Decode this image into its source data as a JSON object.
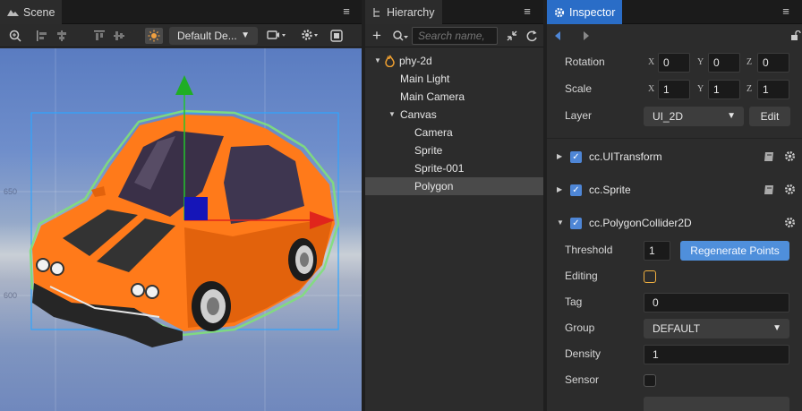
{
  "scene": {
    "tab_label": "Scene",
    "menu_icon": "≡",
    "camera_select": "Default De...",
    "ruler_labels": {
      "y650": "650",
      "y600": "600"
    }
  },
  "hierarchy": {
    "tab_label": "Hierarchy",
    "menu_icon": "≡",
    "search_placeholder": "Search name,",
    "tree": [
      {
        "label": "phy-2d",
        "depth": 0,
        "expanded": true,
        "root": true
      },
      {
        "label": "Main Light",
        "depth": 1
      },
      {
        "label": "Main Camera",
        "depth": 1
      },
      {
        "label": "Canvas",
        "depth": 1,
        "expanded": true
      },
      {
        "label": "Camera",
        "depth": 2
      },
      {
        "label": "Sprite",
        "depth": 2
      },
      {
        "label": "Sprite-001",
        "depth": 2
      },
      {
        "label": "Polygon",
        "depth": 2,
        "selected": true
      }
    ]
  },
  "inspector": {
    "tab_label": "Inspector",
    "menu_icon": "≡",
    "rotation": {
      "label": "Rotation",
      "x": "0",
      "y": "0",
      "z": "0"
    },
    "scale": {
      "label": "Scale",
      "x": "1",
      "y": "1",
      "z": "1"
    },
    "axis_labels": {
      "x": "X",
      "y": "Y",
      "z": "Z"
    },
    "layer": {
      "label": "Layer",
      "value": "UI_2D",
      "edit_label": "Edit"
    },
    "components": {
      "uitransform": "cc.UITransform",
      "sprite": "cc.Sprite",
      "polygon": "cc.PolygonCollider2D"
    },
    "collider": {
      "threshold_label": "Threshold",
      "threshold_value": "1",
      "regenerate_label": "Regenerate Points",
      "editing_label": "Editing",
      "tag_label": "Tag",
      "tag_value": "0",
      "group_label": "Group",
      "group_value": "DEFAULT",
      "density_label": "Density",
      "density_value": "1",
      "sensor_label": "Sensor"
    }
  },
  "colors": {
    "accent": "#4e86d6",
    "active_tab": "#2a6dc7",
    "car_body": "#ff7a1a",
    "selection_box": "#2fa5ff",
    "button_blue": "#4f8fdb"
  }
}
